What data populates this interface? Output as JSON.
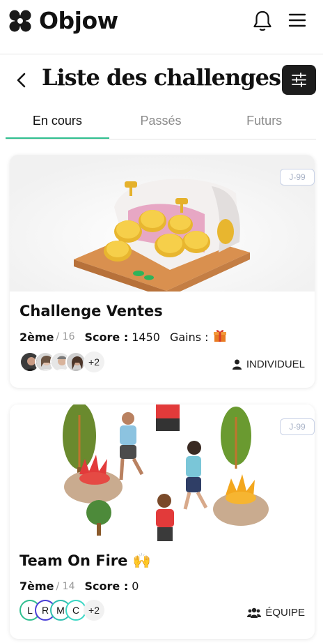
{
  "app": {
    "name": "Objow"
  },
  "header": {
    "title": "Liste des challenges"
  },
  "tabs": [
    {
      "label": "En cours",
      "active": true
    },
    {
      "label": "Passés",
      "active": false
    },
    {
      "label": "Futurs",
      "active": false
    }
  ],
  "colors": {
    "accent": "#2fbf8f",
    "dark": "#1d1d1d",
    "badge": "#aab4c8"
  },
  "challenges": [
    {
      "badge": "J-99",
      "title": "Challenge Ventes",
      "rank": "2ème",
      "rank_total": "/ 16",
      "score_label": "Score :",
      "score_value": "1450",
      "gains_label": "Gains :",
      "gains_icon": "gift-icon",
      "more_count": "+2",
      "type": "INDIVIDUEL",
      "type_icon": "person-icon"
    },
    {
      "badge": "J-99",
      "title": "Team On Fire 🙌",
      "rank": "7ème",
      "rank_total": "/ 14",
      "score_label": "Score :",
      "score_value": "0",
      "team_initials": [
        "L",
        "R",
        "M",
        "C"
      ],
      "team_colors": [
        "#2fbf8f",
        "#4a3fd6",
        "#2fbfb0",
        "#3ad6c4"
      ],
      "more_count": "+2",
      "type": "ÉQUIPE",
      "type_icon": "team-icon"
    }
  ]
}
